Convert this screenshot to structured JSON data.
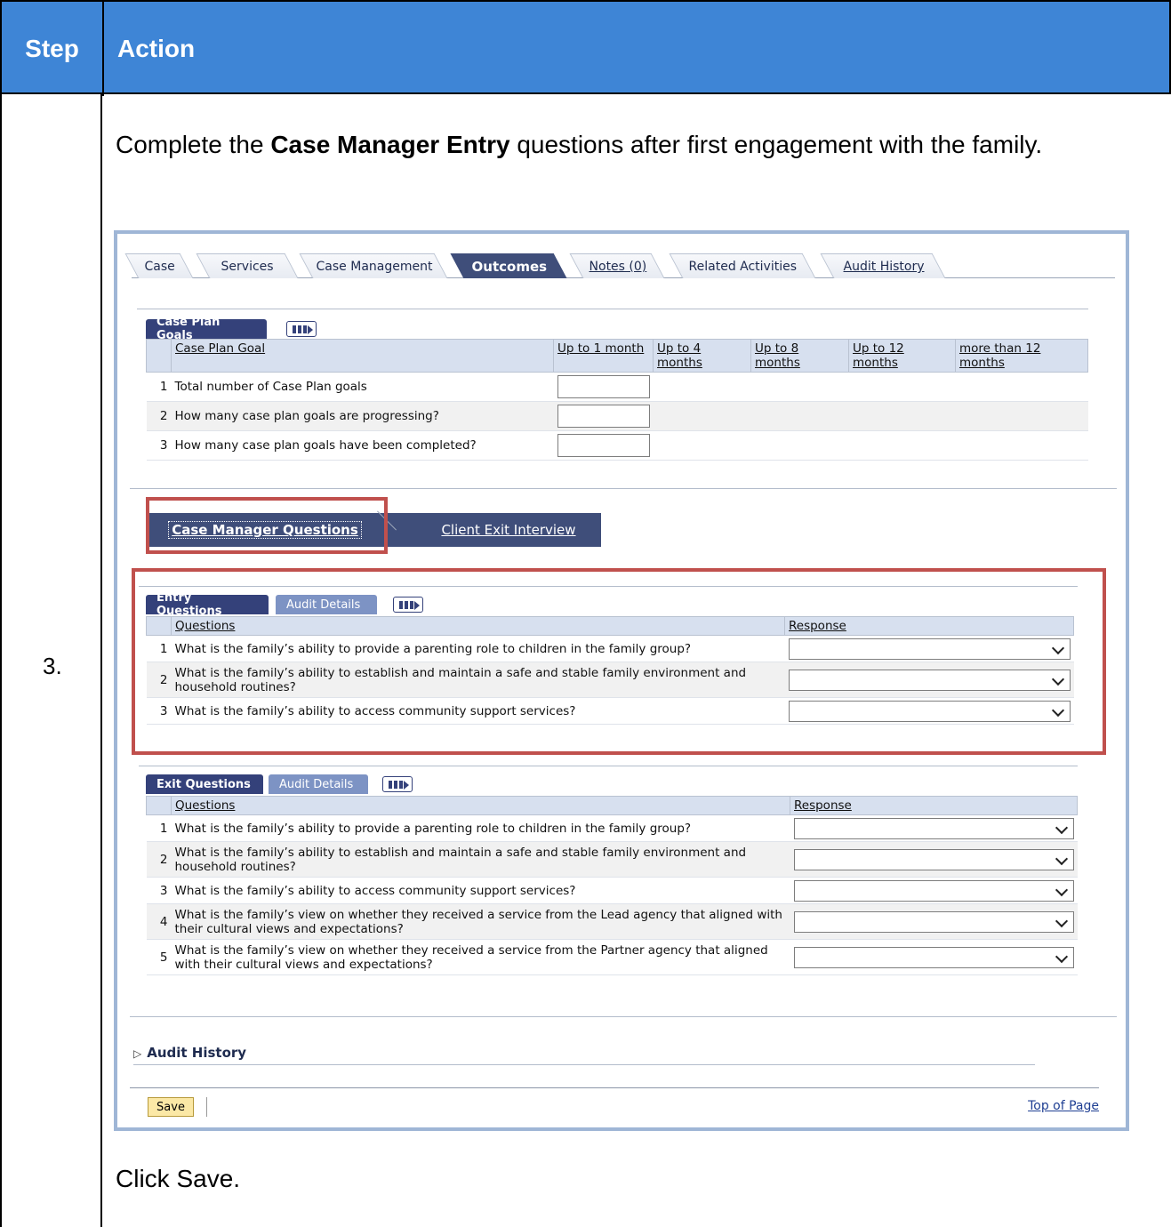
{
  "doc": {
    "header_step": "Step",
    "header_action": "Action",
    "step_number": "3.",
    "instruction_pre": "Complete the ",
    "instruction_bold": "Case Manager Entry",
    "instruction_post": " questions after first engagement with the family.",
    "footer_instruction": "Click Save."
  },
  "tabs": [
    {
      "label": "Case"
    },
    {
      "label": "Services"
    },
    {
      "label": "Case Management"
    },
    {
      "label": "Outcomes"
    },
    {
      "label": "Notes (0)"
    },
    {
      "label": "Related Activities"
    },
    {
      "label": "Audit History"
    }
  ],
  "case_plan": {
    "tab_label": "Case Plan Goals",
    "columns": [
      "Case Plan Goal",
      "Up to 1 month",
      "Up to 4 months",
      "Up to 8 months",
      "Up to 12 months",
      "more than 12 months"
    ],
    "rows": [
      {
        "num": "1",
        "text": "Total number of Case Plan goals"
      },
      {
        "num": "2",
        "text": "How many case plan goals are progressing?"
      },
      {
        "num": "3",
        "text": "How many case plan goals have been completed?"
      }
    ]
  },
  "cm_tabs": {
    "active": "Case Manager Questions",
    "other": "Client Exit Interview"
  },
  "entry": {
    "tab1": "Entry Questions",
    "tab2": "Audit Details",
    "col_questions": "Questions",
    "col_response": "Response",
    "rows": [
      {
        "num": "1",
        "text": "What is the family’s ability to provide a parenting role to children in the family group?"
      },
      {
        "num": "2",
        "text": "What is the family’s ability to establish and maintain a safe and stable family environment and household routines?"
      },
      {
        "num": "3",
        "text": "What is the family’s ability to access community support services?"
      }
    ]
  },
  "exit": {
    "tab1": "Exit Questions",
    "tab2": "Audit Details",
    "col_questions": "Questions",
    "col_response": "Response",
    "rows": [
      {
        "num": "1",
        "text": "What is the family’s ability to provide a parenting role to children in the family group?"
      },
      {
        "num": "2",
        "text": "What is the family’s ability to establish and maintain a safe and stable family environment and household routines?"
      },
      {
        "num": "3",
        "text": "What is the family’s ability to access community support services?"
      },
      {
        "num": "4",
        "text": "What is the family’s view on whether they received a service from the Lead agency that aligned with their cultural views and expectations?"
      },
      {
        "num": "5",
        "text": "What is the family’s view on whether they received a service from the Partner agency that aligned with their cultural views and expectations?"
      }
    ]
  },
  "audit_history": "Audit History",
  "save_label": "Save",
  "top_of_page": "Top of Page",
  "colors": {
    "header_blue": "#3e85d6",
    "highlight_red": "#c0504d",
    "tab_navy": "#3f4e7a"
  }
}
